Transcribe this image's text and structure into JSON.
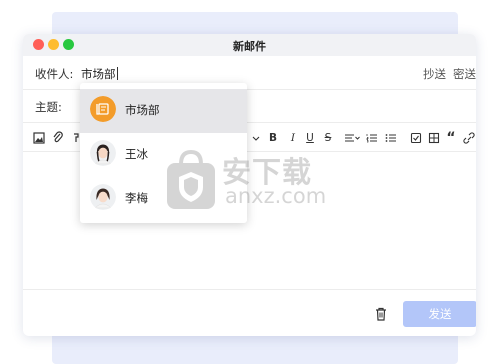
{
  "window": {
    "title": "新邮件"
  },
  "compose": {
    "to_label": "收件人:",
    "to_value": "市场部",
    "cc_label": "抄送",
    "bcc_label": "密送",
    "subject_label": "主题:"
  },
  "toolbar": {
    "items": [
      "image-icon",
      "attach-icon",
      "font-size-dropdown",
      "bold",
      "italic",
      "underline",
      "strikethrough",
      "align",
      "ordered-list",
      "unordered-list",
      "checkbox",
      "table",
      "quote",
      "link"
    ],
    "bold": "B",
    "italic": "I",
    "underline": "U",
    "strike": "S",
    "quote": "“"
  },
  "suggestions": [
    {
      "name": "市场部",
      "avatar": "group-icon",
      "highlighted": true
    },
    {
      "name": "王冰",
      "avatar": "person-avatar",
      "highlighted": false
    },
    {
      "name": "李梅",
      "avatar": "person-avatar",
      "highlighted": false
    }
  ],
  "footer": {
    "send_label": "发送"
  },
  "watermark": {
    "cn": "安下载",
    "en": "anxz.com"
  },
  "colors": {
    "accent_orange": "#f39c2a",
    "send_button": "#b3c6f9",
    "backdrop": "#e9edfb"
  }
}
